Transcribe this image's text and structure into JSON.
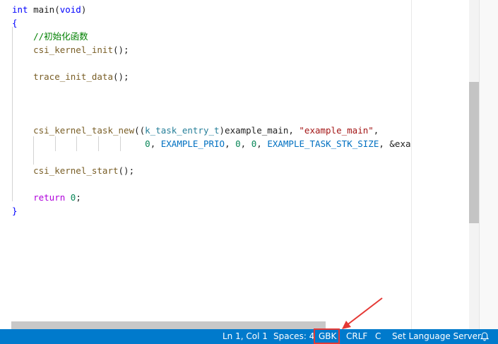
{
  "editor": {
    "lines": [
      {
        "id": "l1",
        "tokens": [
          {
            "t": "int",
            "c": "kw"
          },
          {
            "t": " main(",
            "c": "plain"
          },
          {
            "t": "void",
            "c": "kw"
          },
          {
            "t": ")",
            "c": "plain"
          }
        ]
      },
      {
        "id": "l2",
        "tokens": [
          {
            "t": "{",
            "c": "kw"
          }
        ]
      },
      {
        "id": "l3",
        "tokens": [
          {
            "t": "    //初始化函数",
            "c": "cm"
          }
        ]
      },
      {
        "id": "l4",
        "tokens": [
          {
            "t": "    csi_kernel_init",
            "c": "fn"
          },
          {
            "t": "();",
            "c": "plain"
          }
        ]
      },
      {
        "id": "l5",
        "tokens": []
      },
      {
        "id": "l6",
        "tokens": [
          {
            "t": "    trace_init_data",
            "c": "fn"
          },
          {
            "t": "();",
            "c": "plain"
          }
        ]
      },
      {
        "id": "l7",
        "tokens": []
      },
      {
        "id": "l8",
        "tokens": []
      },
      {
        "id": "l9",
        "tokens": []
      },
      {
        "id": "l10",
        "tokens": [
          {
            "t": "    csi_kernel_task_new",
            "c": "fn"
          },
          {
            "t": "((",
            "c": "plain"
          },
          {
            "t": "k_task_entry_t",
            "c": "type"
          },
          {
            "t": ")example_main, ",
            "c": "plain"
          },
          {
            "t": "\"example_main\"",
            "c": "str"
          },
          {
            "t": ",",
            "c": "plain"
          }
        ]
      },
      {
        "id": "l11",
        "tokens": [
          {
            "t": "                         ",
            "c": "plain"
          },
          {
            "t": "0",
            "c": "num"
          },
          {
            "t": ", ",
            "c": "plain"
          },
          {
            "t": "EXAMPLE_PRIO",
            "c": "macro"
          },
          {
            "t": ", ",
            "c": "plain"
          },
          {
            "t": "0",
            "c": "num"
          },
          {
            "t": ", ",
            "c": "plain"
          },
          {
            "t": "0",
            "c": "num"
          },
          {
            "t": ", ",
            "c": "plain"
          },
          {
            "t": "EXAMPLE_TASK_STK_SIZE",
            "c": "macro"
          },
          {
            "t": ", &exa",
            "c": "plain"
          }
        ]
      },
      {
        "id": "l12",
        "tokens": []
      },
      {
        "id": "l13",
        "tokens": [
          {
            "t": "    csi_kernel_start",
            "c": "fn"
          },
          {
            "t": "();",
            "c": "plain"
          }
        ]
      },
      {
        "id": "l14",
        "tokens": []
      },
      {
        "id": "l15",
        "tokens": [
          {
            "t": "    ",
            "c": "plain"
          },
          {
            "t": "return",
            "c": "ret"
          },
          {
            "t": " ",
            "c": "plain"
          },
          {
            "t": "0",
            "c": "num"
          },
          {
            "t": ";",
            "c": "plain"
          }
        ]
      },
      {
        "id": "l16",
        "tokens": [
          {
            "t": "}",
            "c": "kw"
          }
        ]
      }
    ]
  },
  "statusbar": {
    "cursor_position": "Ln 1, Col 1",
    "indentation": "Spaces: 4",
    "encoding": "GBK",
    "line_ending": "CRLF",
    "language": "C",
    "language_server": "Set Language Server",
    "notifications_icon": "bell-icon"
  },
  "colors": {
    "statusbar_bg": "#007acc",
    "annotation": "#e53935"
  }
}
